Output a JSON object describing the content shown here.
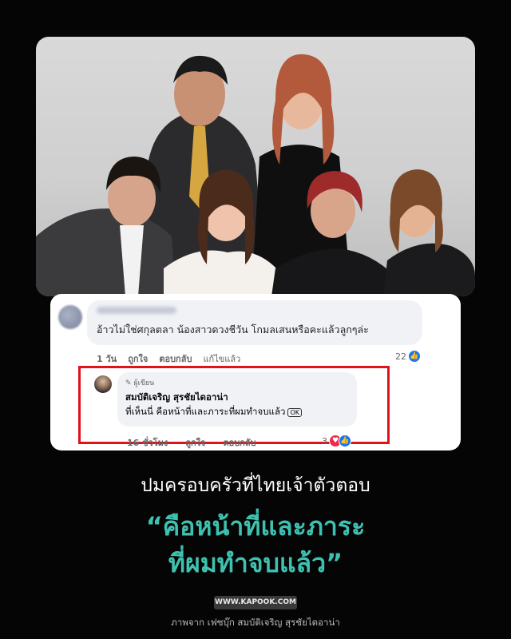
{
  "comment1": {
    "author": "",
    "text": "อ้าวไม่ใช่ศกุลตลา น้องสาวดวงชีวัน โกมลเสนหรือคะแล้วลูกๆล่ะ",
    "time": "1 วัน",
    "like_label": "ถูกใจ",
    "reply_label": "ตอบกลับ",
    "edited_label": "แก้ไขแล้ว",
    "reaction_count": "22",
    "reaction_icon": "like-icon"
  },
  "comment2": {
    "author_tag": "ผู้เขียน",
    "author": "สมบัติเจริญ สุรชัยไดอาน่า",
    "text": "ที่เห็นนี่ คือหน้าที่และภาระที่ผมทำจบแล้ว",
    "emoji_text": "OK",
    "time": "16 ชั่วโมง",
    "like_label": "ถูกใจ",
    "reply_label": "ตอบกลับ",
    "reaction_count": "3",
    "reaction_icons": [
      "love-icon",
      "like-icon"
    ],
    "highlight_color": "#e0121a"
  },
  "headline": "ปมครอบครัวที่ไทยเจ้าตัวตอบ",
  "quote_line1": "“คือหน้าที่และภาระ",
  "quote_line2": "ที่ผมทำจบแล้ว”",
  "quote_color": "#3ec1b0",
  "source": "WWW.KAPOOK.COM",
  "credit": "ภาพจาก เฟซบุ๊ก สมบัติเจริญ สุรชัยไดอาน่า"
}
